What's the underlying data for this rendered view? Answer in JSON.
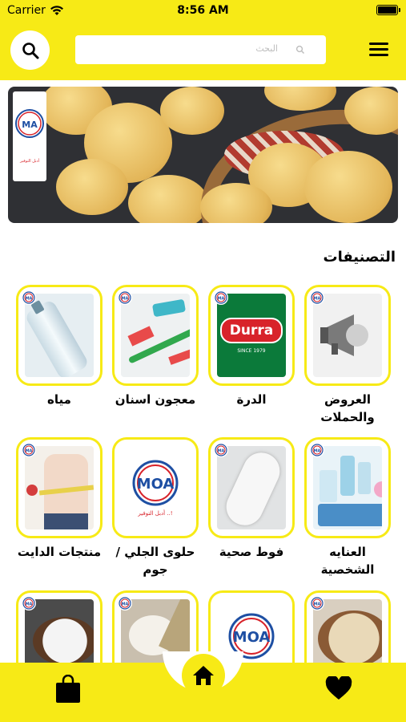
{
  "status_bar": {
    "carrier": "Carrier",
    "time": "8:56 AM"
  },
  "header": {
    "search_placeholder": "البحث"
  },
  "section": {
    "title": "التصنيفات"
  },
  "categories": [
    {
      "label": "العروض والحملات",
      "image": "megaphone"
    },
    {
      "label": "الدرة",
      "image": "durra-logo"
    },
    {
      "label": "معجون اسنان",
      "image": "toothbrush"
    },
    {
      "label": "مياه",
      "image": "water-bottle"
    },
    {
      "label": "العنايه الشخصية",
      "image": "toiletries"
    },
    {
      "label": "فوط صحية",
      "image": "pad"
    },
    {
      "label": "حلوى الجلي / جوم",
      "image": "moa-logo"
    },
    {
      "label": "منتجات الدايت",
      "image": "diet"
    },
    {
      "label": "",
      "image": "oats"
    },
    {
      "label": "",
      "image": "moa-logo"
    },
    {
      "label": "",
      "image": "rice"
    },
    {
      "label": "",
      "image": "salt"
    }
  ],
  "durra_text": {
    "brand": "Durra",
    "since": "SINCE 1979"
  },
  "logo_text": {
    "letters": "MOA",
    "tagline": "أدبل التوفير ..!"
  },
  "colors": {
    "brand_yellow": "#f7ea16",
    "text": "#000000"
  },
  "nav": {
    "left": "shopping-bag-icon",
    "center": "home-icon",
    "right": "heart-icon"
  }
}
